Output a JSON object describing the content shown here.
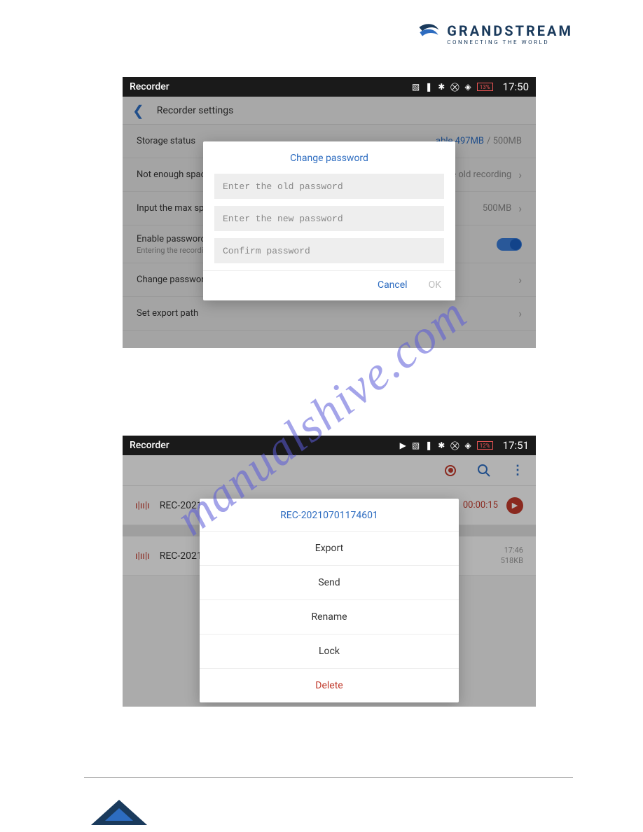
{
  "logo": {
    "brand": "GRANDSTREAM",
    "tagline": "CONNECTING THE WORLD"
  },
  "watermark": "manualshive.com",
  "shot1": {
    "app_title": "Recorder",
    "battery": "13%",
    "clock": "17:50",
    "settings_header": "Recorder settings",
    "rows": {
      "storage_label": "Storage status",
      "storage_avail": "able 497MB",
      "storage_total": "/ 500MB",
      "space_label": "Not enough space fo",
      "space_value": "ce old recording",
      "max_label": "Input the max space",
      "max_value": "500MB",
      "enable_label": "Enable password",
      "enable_sub": "Entering the recording",
      "change_label": "Change password",
      "export_label": "Set export path"
    },
    "dialog": {
      "title": "Change password",
      "ph_old": "Enter the old password",
      "ph_new": "Enter the new password",
      "ph_confirm": "Confirm password",
      "cancel": "Cancel",
      "ok": "OK"
    }
  },
  "shot2": {
    "app_title": "Recorder",
    "battery": "12%",
    "clock": "17:51",
    "rows": {
      "r1_name": "REC-20210701",
      "r1_dur": "00:00:15",
      "r2_name": "REC-20210701",
      "r2_time": "17:46",
      "r2_size": "518KB"
    },
    "menu": {
      "title": "REC-20210701174601",
      "export": "Export",
      "send": "Send",
      "rename": "Rename",
      "lock": "Lock",
      "delete": "Delete"
    }
  }
}
